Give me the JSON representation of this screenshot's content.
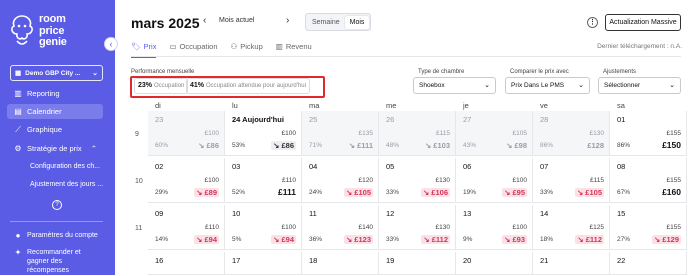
{
  "sidebar": {
    "logo_lines": [
      "room",
      "price",
      "genie"
    ],
    "hotel_name": "Demo GBP City ...",
    "nav": [
      {
        "label": "Reporting",
        "icon": "bar-chart-icon"
      },
      {
        "label": "Calendrier",
        "icon": "calendar-icon",
        "active": true
      },
      {
        "label": "Graphique",
        "icon": "line-chart-icon"
      },
      {
        "label": "Stratégie de prix",
        "icon": "tune-icon"
      }
    ],
    "sub_items": [
      "Configuration des ch...",
      "Ajustement des jours ..."
    ],
    "account_label": "Paramètres du compte",
    "recommend_lines": [
      "Recommander et",
      "gagner des",
      "récompenses"
    ]
  },
  "header": {
    "title": "mars 2025",
    "current_month_btn": "Mois actuel",
    "view_week": "Semaine",
    "view_month": "Mois",
    "action_btn": "Actualization Massive"
  },
  "tabs": [
    {
      "label": "Prix",
      "active": true
    },
    {
      "label": "Occupation"
    },
    {
      "label": "Pickup"
    },
    {
      "label": "Revenu"
    }
  ],
  "last_download": "Dernier téléchargement : n.A.",
  "performance": {
    "label": "Performance mensuelle",
    "occupancy_value": "23%",
    "occupancy_label": "Occupation",
    "expected_value": "41%",
    "expected_label": "Occupation attendue pour aujourd'hui"
  },
  "filters": {
    "room_type_label": "Type de chambre",
    "room_type_value": "Shoebox",
    "compare_label": "Comparer le prix avec",
    "compare_value": "Prix Dans Le PMS",
    "adjust_label": "Ajustements",
    "adjust_value": "Sélectionner"
  },
  "calendar": {
    "day_names": [
      "di",
      "lu",
      "ma",
      "me",
      "je",
      "ve",
      "sa"
    ],
    "weeks": [
      {
        "num": "9",
        "days": [
          {
            "d": "23",
            "pr": "£100",
            "occ": "60%",
            "sug": "↘ £86",
            "past": true
          },
          {
            "d": "24 Aujourd'hui",
            "pr": "£100",
            "occ": "53%",
            "sug": "↘ £86",
            "past": false,
            "grey": true
          },
          {
            "d": "25",
            "pr": "£135",
            "occ": "71%",
            "sug": "↘ £111",
            "past": true
          },
          {
            "d": "26",
            "pr": "£115",
            "occ": "48%",
            "sug": "↘ £103",
            "past": true
          },
          {
            "d": "27",
            "pr": "£105",
            "occ": "43%",
            "sug": "↘ £98",
            "past": true
          },
          {
            "d": "28",
            "pr": "£130",
            "occ": "86%",
            "sug": "£128",
            "past": true
          },
          {
            "d": "01",
            "pr": "£155",
            "occ": "86%",
            "sug": "£150",
            "past": false
          }
        ]
      },
      {
        "num": "10",
        "days": [
          {
            "d": "02",
            "pr": "£100",
            "occ": "29%",
            "sug": "↘ £89",
            "red": true
          },
          {
            "d": "03",
            "pr": "£110",
            "occ": "52%",
            "sug": "£111"
          },
          {
            "d": "04",
            "pr": "£120",
            "occ": "24%",
            "sug": "↘ £105",
            "red": true
          },
          {
            "d": "05",
            "pr": "£130",
            "occ": "33%",
            "sug": "↘ £106",
            "red": true
          },
          {
            "d": "06",
            "pr": "£100",
            "occ": "19%",
            "sug": "↘ £95",
            "red": true
          },
          {
            "d": "07",
            "pr": "£115",
            "occ": "33%",
            "sug": "↘ £105",
            "red": true
          },
          {
            "d": "08",
            "pr": "£155",
            "occ": "67%",
            "sug": "£160"
          }
        ]
      },
      {
        "num": "11",
        "days": [
          {
            "d": "09",
            "pr": "£110",
            "occ": "14%",
            "sug": "↘ £94",
            "red": true
          },
          {
            "d": "10",
            "pr": "£100",
            "occ": "5%",
            "sug": "↘ £94",
            "red": true
          },
          {
            "d": "11",
            "pr": "£140",
            "occ": "36%",
            "sug": "↘ £123",
            "red": true
          },
          {
            "d": "12",
            "pr": "£130",
            "occ": "33%",
            "sug": "↘ £112",
            "red": true
          },
          {
            "d": "13",
            "pr": "£100",
            "occ": "9%",
            "sug": "↘ £93",
            "red": true
          },
          {
            "d": "14",
            "pr": "£125",
            "occ": "18%",
            "sug": "↘ £112",
            "red": true
          },
          {
            "d": "15",
            "pr": "£155",
            "occ": "27%",
            "sug": "↘ £129",
            "red": true
          }
        ]
      },
      {
        "num": "",
        "days": [
          {
            "d": "16"
          },
          {
            "d": "17"
          },
          {
            "d": "18"
          },
          {
            "d": "19"
          },
          {
            "d": "20"
          },
          {
            "d": "21"
          },
          {
            "d": "22"
          }
        ]
      }
    ]
  },
  "colors": {
    "brand": "#5a5ce6",
    "highlight": "#e0292c",
    "down_badge": "#d6335b"
  }
}
